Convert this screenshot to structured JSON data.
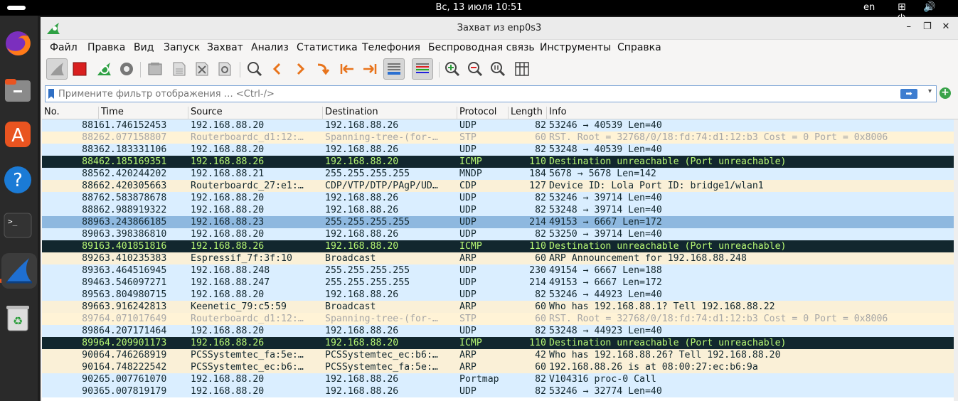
{
  "topbar": {
    "clock": "Вс, 13 июля  10:51",
    "lang": "en",
    "sys_icons": "⊞ 🔊 ⏻"
  },
  "dock": {
    "items": [
      "firefox-icon",
      "files-icon",
      "app-center-icon",
      "help-icon",
      "terminal-icon",
      "wireshark-icon",
      "trash-icon"
    ]
  },
  "window": {
    "title": "Захват из enp0s3",
    "minimize": "–",
    "maximize": "❐",
    "close": "✕"
  },
  "menu": [
    "Файл",
    "Правка",
    "Вид",
    "Запуск",
    "Захват",
    "Анализ",
    "Статистика",
    "Телефония",
    "Беспроводная связь",
    "Инструменты",
    "Справка"
  ],
  "toolbar": [
    "start-capture-icon",
    "stop-capture-icon",
    "restart-capture-icon",
    "capture-options-icon",
    "open-file-icon",
    "save-file-icon",
    "close-file-icon",
    "reload-file-icon",
    "find-packet-icon",
    "go-back-icon",
    "go-forward-icon",
    "go-to-packet-icon",
    "go-first-icon",
    "go-last-icon",
    "autoscroll-icon",
    "colorize-icon",
    "zoom-in-icon",
    "zoom-out-icon",
    "zoom-normal-icon",
    "resize-columns-icon"
  ],
  "filter": {
    "placeholder": "Примените фильтр отображения … <Ctrl-/>",
    "apply_arrow": "➡",
    "dropdown": "▾",
    "add": "+"
  },
  "columns": {
    "no": "No.",
    "time": "Time",
    "source": "Source",
    "destination": "Destination",
    "protocol": "Protocol",
    "length": "Length",
    "info": "Info"
  },
  "colors": {
    "udp_bg": "#daeeff",
    "udp_fg": "#12272e",
    "stp_bg": "#fff3d6",
    "stp_fg": "#a7a7a7",
    "icmp_bg": "#12272e",
    "icmp_fg": "#b7f774",
    "arp_bg": "#faf0d7",
    "arp_fg": "#12272e",
    "selected_bg": "#8eb8df"
  },
  "packets": [
    {
      "no": "881",
      "time": "61.746152453",
      "src": "192.168.88.20",
      "dst": "192.168.88.26",
      "proto": "UDP",
      "len": "82",
      "info": "53246 → 40539 Len=40",
      "style": "udp"
    },
    {
      "no": "882",
      "time": "62.077158807",
      "src": "Routerboardc_d1:12:…",
      "dst": "Spanning-tree-(for-…",
      "proto": "STP",
      "len": "60",
      "info": "RST. Root = 32768/0/18:fd:74:d1:12:b3  Cost = 0  Port = 0x8006",
      "style": "stp"
    },
    {
      "no": "883",
      "time": "62.183331106",
      "src": "192.168.88.20",
      "dst": "192.168.88.26",
      "proto": "UDP",
      "len": "82",
      "info": "53248 → 40539 Len=40",
      "style": "udp"
    },
    {
      "no": "884",
      "time": "62.185169351",
      "src": "192.168.88.26",
      "dst": "192.168.88.20",
      "proto": "ICMP",
      "len": "110",
      "info": "Destination unreachable (Port unreachable)",
      "style": "icmp"
    },
    {
      "no": "885",
      "time": "62.420244202",
      "src": "192.168.88.21",
      "dst": "255.255.255.255",
      "proto": "MNDP",
      "len": "184",
      "info": "5678 → 5678 Len=142",
      "style": "udp"
    },
    {
      "no": "886",
      "time": "62.420305663",
      "src": "Routerboardc_27:e1:…",
      "dst": "CDP/VTP/DTP/PAgP/UD…",
      "proto": "CDP",
      "len": "127",
      "info": "Device ID: Lola  Port ID: bridge1/wlan1",
      "style": "arp"
    },
    {
      "no": "887",
      "time": "62.583878678",
      "src": "192.168.88.20",
      "dst": "192.168.88.26",
      "proto": "UDP",
      "len": "82",
      "info": "53246 → 39714 Len=40",
      "style": "udp"
    },
    {
      "no": "888",
      "time": "62.988919322",
      "src": "192.168.88.20",
      "dst": "192.168.88.26",
      "proto": "UDP",
      "len": "82",
      "info": "53248 → 39714 Len=40",
      "style": "udp"
    },
    {
      "no": "889",
      "time": "63.243866185",
      "src": "192.168.88.23",
      "dst": "255.255.255.255",
      "proto": "UDP",
      "len": "214",
      "info": "49153 → 6667 Len=172",
      "style": "selected"
    },
    {
      "no": "890",
      "time": "63.398386810",
      "src": "192.168.88.20",
      "dst": "192.168.88.26",
      "proto": "UDP",
      "len": "82",
      "info": "53250 → 39714 Len=40",
      "style": "udp"
    },
    {
      "no": "891",
      "time": "63.401851816",
      "src": "192.168.88.26",
      "dst": "192.168.88.20",
      "proto": "ICMP",
      "len": "110",
      "info": "Destination unreachable (Port unreachable)",
      "style": "icmp"
    },
    {
      "no": "892",
      "time": "63.410235383",
      "src": "Espressif_7f:3f:10",
      "dst": "Broadcast",
      "proto": "ARP",
      "len": "60",
      "info": "ARP Announcement for 192.168.88.248",
      "style": "arp"
    },
    {
      "no": "893",
      "time": "63.464516945",
      "src": "192.168.88.248",
      "dst": "255.255.255.255",
      "proto": "UDP",
      "len": "230",
      "info": "49154 → 6667 Len=188",
      "style": "udp"
    },
    {
      "no": "894",
      "time": "63.546097271",
      "src": "192.168.88.247",
      "dst": "255.255.255.255",
      "proto": "UDP",
      "len": "214",
      "info": "49153 → 6667 Len=172",
      "style": "udp"
    },
    {
      "no": "895",
      "time": "63.804980715",
      "src": "192.168.88.20",
      "dst": "192.168.88.26",
      "proto": "UDP",
      "len": "82",
      "info": "53246 → 44923 Len=40",
      "style": "udp"
    },
    {
      "no": "896",
      "time": "63.916242813",
      "src": "Keenetic_79:c5:59",
      "dst": "Broadcast",
      "proto": "ARP",
      "len": "60",
      "info": "Who has 192.168.88.1? Tell 192.168.88.22",
      "style": "arp"
    },
    {
      "no": "897",
      "time": "64.071017649",
      "src": "Routerboardc_d1:12:…",
      "dst": "Spanning-tree-(for-…",
      "proto": "STP",
      "len": "60",
      "info": "RST. Root = 32768/0/18:fd:74:d1:12:b3  Cost = 0  Port = 0x8006",
      "style": "stp"
    },
    {
      "no": "898",
      "time": "64.207171464",
      "src": "192.168.88.20",
      "dst": "192.168.88.26",
      "proto": "UDP",
      "len": "82",
      "info": "53248 → 44923 Len=40",
      "style": "udp"
    },
    {
      "no": "899",
      "time": "64.209901173",
      "src": "192.168.88.26",
      "dst": "192.168.88.20",
      "proto": "ICMP",
      "len": "110",
      "info": "Destination unreachable (Port unreachable)",
      "style": "icmp"
    },
    {
      "no": "900",
      "time": "64.746268919",
      "src": "PCSSystemtec_fa:5e:…",
      "dst": "PCSSystemtec_ec:b6:…",
      "proto": "ARP",
      "len": "42",
      "info": "Who has 192.168.88.26? Tell 192.168.88.20",
      "style": "arp"
    },
    {
      "no": "901",
      "time": "64.748222542",
      "src": "PCSSystemtec_ec:b6:…",
      "dst": "PCSSystemtec_fa:5e:…",
      "proto": "ARP",
      "len": "60",
      "info": "192.168.88.26 is at 08:00:27:ec:b6:9a",
      "style": "arp"
    },
    {
      "no": "902",
      "time": "65.007761070",
      "src": "192.168.88.20",
      "dst": "192.168.88.26",
      "proto": "Portmap",
      "len": "82",
      "info": "V104316 proc-0 Call",
      "style": "udp"
    },
    {
      "no": "903",
      "time": "65.007819179",
      "src": "192.168.88.20",
      "dst": "192.168.88.26",
      "proto": "UDP",
      "len": "82",
      "info": "53246 → 32774 Len=40",
      "style": "udp"
    }
  ]
}
